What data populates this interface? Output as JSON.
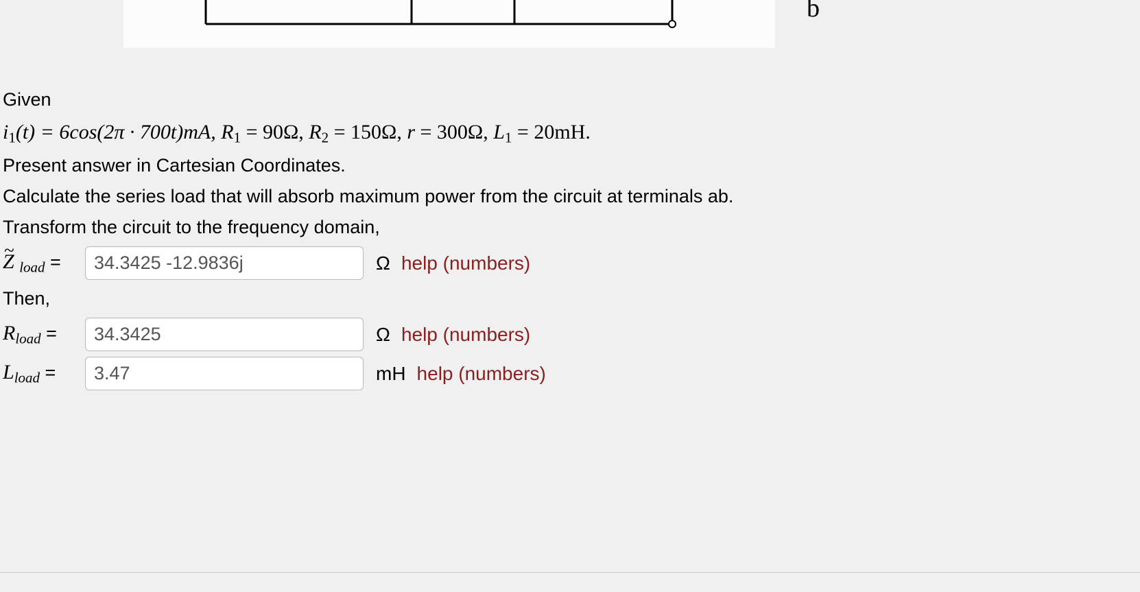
{
  "circuit": {
    "terminal_label": "b"
  },
  "text": {
    "given": "Given",
    "present": "Present answer in Cartesian Coordinates.",
    "calculate": "Calculate the series load that will absorb maximum power from the circuit at terminals ab.",
    "transform": "Transform the circuit to the frequency domain,",
    "then": "Then,"
  },
  "equation": {
    "i1": "i",
    "i1_sub": "1",
    "i1_arg": "(t) = 6cos(2π · 700t)mA, ",
    "R1": "R",
    "R1_sub": "1",
    "R1_val": " = 90Ω, ",
    "R2": "R",
    "R2_sub": "2",
    "R2_val": " = 150Ω, ",
    "r": "r",
    "r_val": " = 300Ω, ",
    "L1": "L",
    "L1_sub": "1",
    "L1_val": " = 20mH."
  },
  "rows": {
    "zload": {
      "sym": "Z",
      "sub": "load",
      "value": "34.3425 -12.9836j",
      "unit": "Ω",
      "help": "help (numbers)"
    },
    "rload": {
      "sym": "R",
      "sub": "load",
      "value": "34.3425",
      "unit": "Ω",
      "help": "help (numbers)"
    },
    "lload": {
      "sym": "L",
      "sub": "load",
      "value": "3.47",
      "unit": "mH",
      "help": "help (numbers)"
    }
  }
}
